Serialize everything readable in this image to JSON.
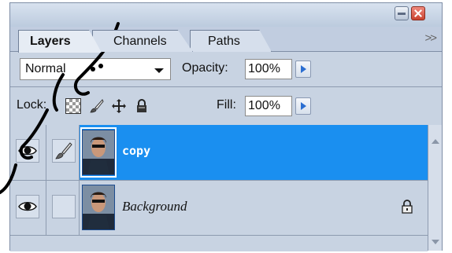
{
  "window": {
    "minimize_icon": "minimize-icon",
    "close_icon": "close-icon"
  },
  "tabs": [
    {
      "label": "Layers",
      "active": true
    },
    {
      "label": "Channels",
      "active": false
    },
    {
      "label": "Paths",
      "active": false
    }
  ],
  "menu_icon": "panel-menu-double-chevron-icon",
  "blend": {
    "mode": "Normal",
    "opacity_label": "Opacity:",
    "opacity_value": "100%"
  },
  "lock": {
    "label": "Lock:",
    "icons": [
      "lock-transparent-pixels-icon",
      "lock-image-pixels-icon",
      "lock-position-icon",
      "lock-all-icon"
    ],
    "fill_label": "Fill:",
    "fill_value": "100%"
  },
  "layers": [
    {
      "name": "copy",
      "selected": true,
      "visible": true,
      "linked_brush": true,
      "locked": false
    },
    {
      "name": "Background",
      "selected": false,
      "visible": true,
      "linked_brush": false,
      "locked": true
    }
  ],
  "colors": {
    "panel_bg": "#c8d3e2",
    "selected_row": "#1a8ff0",
    "close_button": "#c9422f"
  }
}
